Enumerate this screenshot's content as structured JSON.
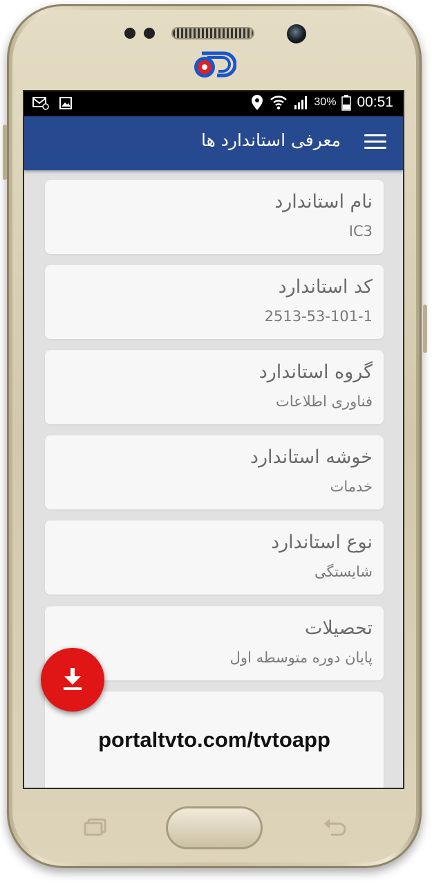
{
  "colors": {
    "appbar": "#27498f",
    "fab": "#e01616",
    "screen_bg": "#e1e1e1",
    "card_bg": "#f7f7f7"
  },
  "status_bar": {
    "battery_percent": "30%",
    "time": "00:51",
    "icons": [
      "message-icon",
      "image-icon",
      "location-icon",
      "wifi-icon",
      "signal-icon",
      "battery-icon"
    ]
  },
  "app_bar": {
    "title": "معرفی استاندارد ها",
    "menu_icon": "hamburger-menu-icon"
  },
  "cards": [
    {
      "title": "نام استاندارد",
      "value": "IC3"
    },
    {
      "title": "کد استاندارد",
      "value": "2513-53-101-1"
    },
    {
      "title": "گروه استاندارد",
      "value": "فناوری اطلاعات"
    },
    {
      "title": "خوشه استاندارد",
      "value": "خدمات"
    },
    {
      "title": "نوع استاندارد",
      "value": "شایستگی"
    },
    {
      "title": "تحصیلات",
      "value": "پایان دوره متوسطه اول"
    }
  ],
  "footer_card": {
    "url": "portaltvto.com/tvtoapp"
  },
  "fab": {
    "icon": "download-icon"
  }
}
